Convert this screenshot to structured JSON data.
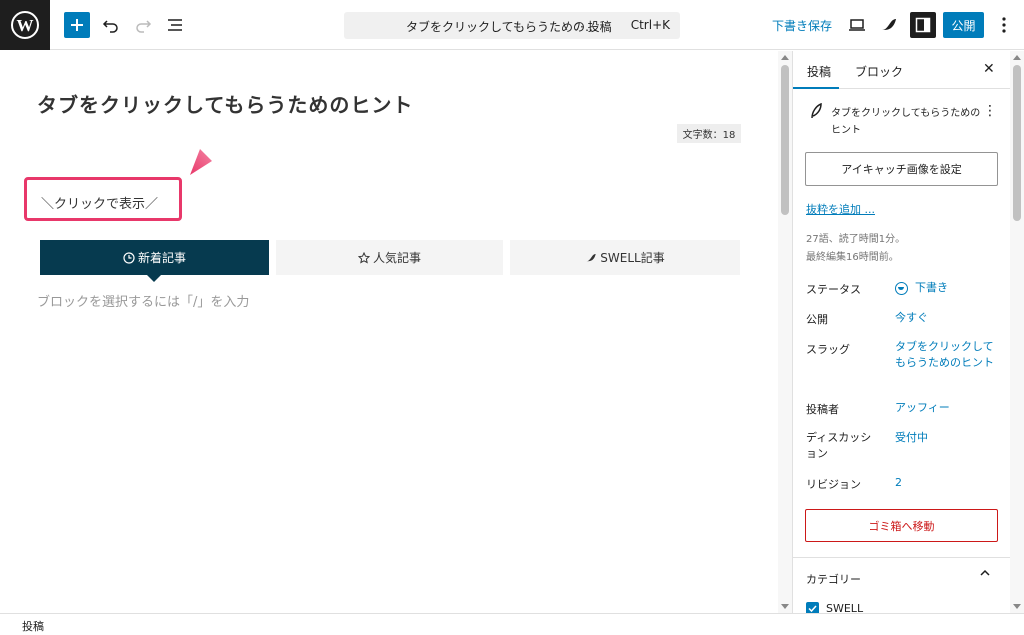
{
  "toolbar": {
    "command_title": "タブをクリックしてもらうための…",
    "command_type": "· 投稿",
    "command_shortcut": "Ctrl+K",
    "save_draft": "下書き保存",
    "publish": "公開"
  },
  "editor": {
    "post_title": "タブをクリックしてもらうためのヒント",
    "word_count": "文字数：18",
    "click_note": "＼クリックで表示／",
    "tabs": [
      {
        "label": "新着記事",
        "icon": "clock-icon",
        "active": true
      },
      {
        "label": "人気記事",
        "icon": "star-icon",
        "active": false
      },
      {
        "label": "SWELL記事",
        "icon": "swell-logo-icon",
        "active": false
      }
    ],
    "placeholder": "ブロックを選択するには「/」を入力"
  },
  "sidebar": {
    "tab_post": "投稿",
    "tab_block": "ブロック",
    "post_title": "タブをクリックしてもらうためのヒント",
    "featured_image_button": "アイキャッチ画像を設定",
    "excerpt_link": "抜粋を追加 ...",
    "meta_words": "27語、読了時間1分。",
    "meta_edited": "最終編集16時間前。",
    "rows": {
      "status": {
        "label": "ステータス",
        "value": "下書き"
      },
      "publish": {
        "label": "公開",
        "value": "今すぐ"
      },
      "slug": {
        "label": "スラッグ",
        "value": "タブをクリックしてもらうためのヒント"
      },
      "author": {
        "label": "投稿者",
        "value": "アッフィー"
      },
      "discussion": {
        "label": "ディスカッション",
        "value": "受付中"
      },
      "revision": {
        "label": "リビジョン",
        "value": "2"
      }
    },
    "trash_button": "ゴミ箱へ移動",
    "category_title": "カテゴリー",
    "categories": [
      {
        "label": "SWELL",
        "checked": true
      }
    ]
  },
  "footer": {
    "breadcrumb": "投稿"
  },
  "colors": {
    "accent": "#007cba",
    "tab_active": "#063a4f",
    "highlight": "#e8386a",
    "danger": "#cc1818"
  }
}
